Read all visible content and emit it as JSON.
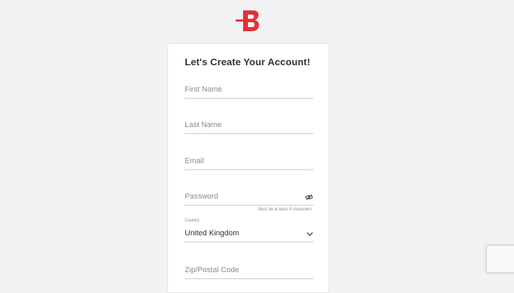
{
  "brand": {
    "logo_icon": "brand-b-logo-icon",
    "accent_color": "#e0323a"
  },
  "form": {
    "title": "Let's Create Your Account!",
    "first_name": {
      "placeholder": "First Name"
    },
    "last_name": {
      "placeholder": "Last Name"
    },
    "email": {
      "placeholder": "Email"
    },
    "password": {
      "placeholder": "Password",
      "hint": "Must be at least 6 characters",
      "toggle_icon": "eye-slash-icon"
    },
    "country": {
      "label": "Country",
      "value": "United Kingdom",
      "icon": "chevron-down-icon"
    },
    "zip": {
      "placeholder": "Zip/Postal Code"
    }
  },
  "recaptcha": {
    "icon": "recaptcha-badge-icon"
  }
}
